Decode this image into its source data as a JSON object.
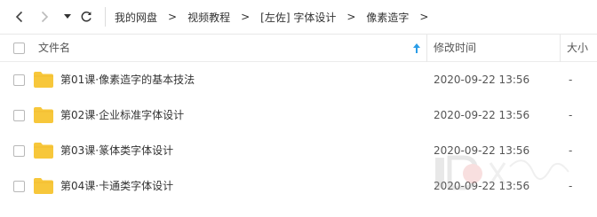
{
  "nav": {
    "back_icon": "chevron-left-icon",
    "forward_icon": "chevron-right-icon",
    "dropdown_icon": "caret-down-icon",
    "refresh_icon": "refresh-icon"
  },
  "breadcrumb": {
    "items": [
      "我的网盘",
      "视频教程",
      "[左佐] 字体设计",
      "像素造字"
    ],
    "separator": ">"
  },
  "columns": {
    "name": "文件名",
    "modified": "修改时间",
    "size": "大小"
  },
  "sort_color": "#2a9de8",
  "folder_color": "#f7c73b",
  "files": [
    {
      "name": "第01课·像素造字的基本技法",
      "modified": "2020-09-22 13:56",
      "size": "-"
    },
    {
      "name": "第02课·企业标准字体设计",
      "modified": "2020-09-22 13:56",
      "size": "-"
    },
    {
      "name": "第03课·篆体类字体设计",
      "modified": "2020-09-22 13:56",
      "size": "-"
    },
    {
      "name": "第04课·卡通类字体设计",
      "modified": "2020-09-22 13:56",
      "size": "-"
    }
  ]
}
